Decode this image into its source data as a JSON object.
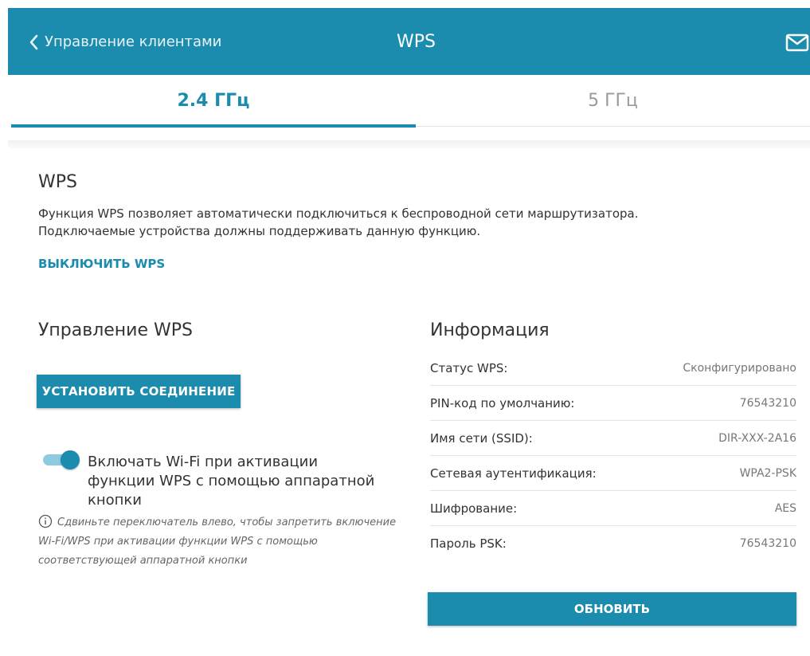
{
  "header": {
    "back_label": "Управление клиентами",
    "title": "WPS",
    "mail_icon": "mail-icon",
    "background": "#1b8cae"
  },
  "tabs": [
    {
      "label": "2.4 ГГц",
      "active": true
    },
    {
      "label": "5 ГГц",
      "active": false
    }
  ],
  "wps": {
    "title": "WPS",
    "description": "Функция WPS позволяет автоматически подключиться к беспроводной сети маршрутизатора. Подключаемые устройства должны поддерживать данную функцию.",
    "disable_link": "ВЫКЛЮЧИТЬ WPS"
  },
  "control": {
    "title": "Управление WPS",
    "connect_button": "УСТАНОВИТЬ СОЕДИНЕНИЕ",
    "toggle_on": true,
    "toggle_label": "Включать Wi-Fi при активации функции WPS с помощью аппаратной кнопки",
    "hint": "Сдвиньте переключатель влево, чтобы запретить включение Wi-Fi/WPS при активации функции WPS с помощью соответствующей аппаратной кнопки"
  },
  "info": {
    "title": "Информация",
    "rows": [
      {
        "label": "Статус WPS:",
        "value": "Сконфигурировано"
      },
      {
        "label": "PIN-код по умолчанию:",
        "value": "76543210"
      },
      {
        "label": "Имя сети (SSID):",
        "value": "DIR-XXX-2A16"
      },
      {
        "label": "Сетевая аутентификация:",
        "value": "WPA2-PSK"
      },
      {
        "label": "Шифрование:",
        "value": "AES"
      },
      {
        "label": "Пароль PSK:",
        "value": "76543210"
      }
    ],
    "refresh_button": "ОБНОВИТЬ"
  },
  "colors": {
    "accent": "#1b8cae",
    "toggle_track": "#8fcbe0"
  }
}
